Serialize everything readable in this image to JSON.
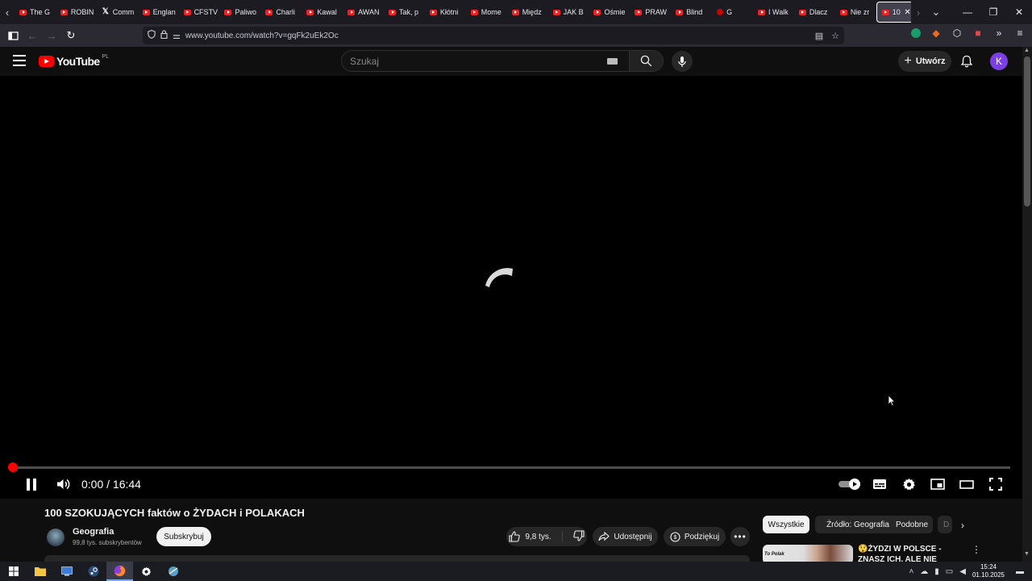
{
  "browser": {
    "tabs": [
      {
        "label": "The G",
        "icon": "web-icon"
      },
      {
        "label": "ROBIN",
        "icon": "youtube-icon"
      },
      {
        "label": "Comm",
        "icon": "x-icon"
      },
      {
        "label": "Englan",
        "icon": "youtube-icon"
      },
      {
        "label": "CFSTV",
        "icon": "youtube-icon"
      },
      {
        "label": "Paliwo",
        "icon": "youtube-icon"
      },
      {
        "label": "Charli",
        "icon": "youtube-icon"
      },
      {
        "label": "Kawal",
        "icon": "youtube-icon"
      },
      {
        "label": "AWAN",
        "icon": "youtube-icon"
      },
      {
        "label": "Tak, p",
        "icon": "youtube-icon"
      },
      {
        "label": "Kłótni",
        "icon": "youtube-icon"
      },
      {
        "label": "Mome",
        "icon": "youtube-icon"
      },
      {
        "label": "Międz",
        "icon": "youtube-icon"
      },
      {
        "label": "JAK B",
        "icon": "youtube-icon"
      },
      {
        "label": "Ośmie",
        "icon": "youtube-icon"
      },
      {
        "label": "PRAW",
        "icon": "youtube-icon"
      },
      {
        "label": "Blind",
        "icon": "youtube-icon"
      },
      {
        "label": "G",
        "icon": "recording-icon"
      },
      {
        "label": "I Walk",
        "icon": "youtube-icon"
      },
      {
        "label": "Dlacz",
        "icon": "youtube-icon"
      },
      {
        "label": "Nie zr",
        "icon": "youtube-icon"
      },
      {
        "label": "100",
        "icon": "youtube-icon",
        "active": true
      }
    ],
    "url": "www.youtube.com/watch?v=gqFk2uEk2Oc"
  },
  "youtube": {
    "logo_text": "YouTube",
    "country_code": "PL",
    "search_placeholder": "Szukaj",
    "create_label": "Utwórz",
    "avatar_letter": "K"
  },
  "player": {
    "time_display": "0:00 / 16:44",
    "current_time": "0:00",
    "duration": "16:44",
    "progress_fraction": 0,
    "state": "loading"
  },
  "video": {
    "title": "100 SZOKUJĄCYCH faktów o ŻYDACH i POLAKACH",
    "channel_name": "Geografia",
    "subscribers": "99,8 tys. subskrybentów",
    "subscribe_label": "Subskrybuj",
    "likes": "9,8 tys.",
    "share_label": "Udostępnij",
    "thanks_label": "Podziękuj"
  },
  "recommendations": {
    "chips": [
      "Wszystkie",
      "Źródło: Geografia",
      "Podobne",
      "D"
    ],
    "active_chip": "Wszystkie",
    "first_title": "😲ŻYDZI W POLSCE - ZNASZ ICH, ALE NIE WIESZ, ŻE SĄ",
    "first_thumb_text": "To Polak"
  },
  "taskbar": {
    "time": "15:24",
    "date": "01.10.2025"
  },
  "colors": {
    "accent": "#ff0000",
    "avatar": "#7b3fe4",
    "background": "#0f0f0f"
  }
}
